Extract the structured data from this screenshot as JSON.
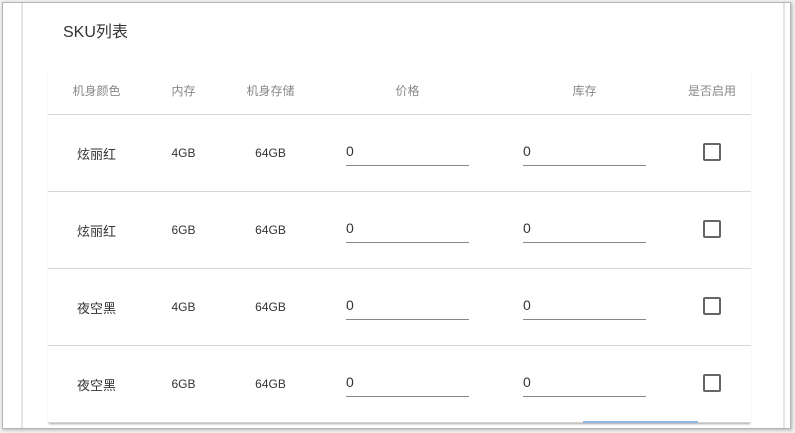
{
  "title": "SKU列表",
  "headers": [
    "机身颜色",
    "内存",
    "机身存储",
    "价格",
    "库存",
    "是否启用"
  ],
  "rows": [
    {
      "color": "炫丽红",
      "memory": "4GB",
      "storage": "64GB",
      "price": "0",
      "stock": "0",
      "enabled": false
    },
    {
      "color": "炫丽红",
      "memory": "6GB",
      "storage": "64GB",
      "price": "0",
      "stock": "0",
      "enabled": false
    },
    {
      "color": "夜空黑",
      "memory": "4GB",
      "storage": "64GB",
      "price": "0",
      "stock": "0",
      "enabled": false
    },
    {
      "color": "夜空黑",
      "memory": "6GB",
      "storage": "64GB",
      "price": "0",
      "stock": "0",
      "enabled": false
    }
  ]
}
